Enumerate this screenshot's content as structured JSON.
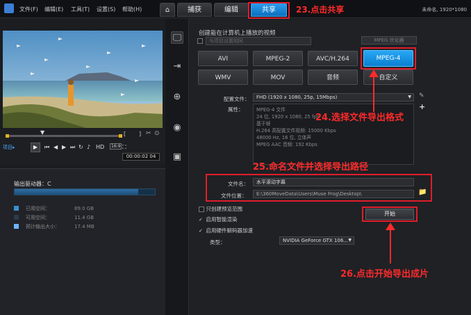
{
  "menu": [
    "文件(F)",
    "编辑(E)",
    "工具(T)",
    "设置(S)",
    "帮助(H)"
  ],
  "tabs": {
    "home_icon": "home-icon",
    "capture": "捕获",
    "edit": "编辑",
    "share": "共享"
  },
  "project_info": "未命名, 1920*1080",
  "annotations": {
    "step23": "23.点击共享",
    "step24": "24.选择文件导出格式",
    "step25": "25.命名文件并选择导出路径",
    "step26": "26.点击开始导出成片"
  },
  "player": {
    "mode_label": "项目▸",
    "timecode": "00:00:02 04",
    "hd_label": "HD",
    "ratio_label": "16:9"
  },
  "drive": {
    "label": "输出驱动器：C",
    "used_fraction": 0.88,
    "rows": [
      {
        "label": "已用空间：",
        "value": "89.0 GB",
        "color": "#3a8fd0"
      },
      {
        "label": "可用空间：",
        "value": "11.4 GB",
        "color": "#2b3a4a"
      },
      {
        "label": "预计输出大小：",
        "value": "17.4 MB",
        "color": "#6fb4ff"
      }
    ]
  },
  "share": {
    "heading": "创建能在计算机上播放的视频",
    "sub_option": "与项目设置相同",
    "mpeg_opt": "MPEG 优化器",
    "formats_row1": [
      "AVI",
      "MPEG-2",
      "AVC/H.264",
      "MPEG-4"
    ],
    "formats_row2": [
      "WMV",
      "MOV",
      "音频",
      "自定义"
    ],
    "selected_format": "MPEG-4",
    "profile_label": "配置文件：",
    "profile_value": "FHD (1920 x 1080, 25p, 15Mbps)",
    "props_label": "属性：",
    "props_lines": [
      "MPEG-4 文件",
      "24 位, 1920 x 1080, 25 fps",
      "基于帧",
      "H.264 高配置文件视频: 15000 Kbps",
      "48000 Hz, 16 位, 立体声",
      "MPEG AAC 音频: 192 Kbps"
    ],
    "filename_label": "文件名：",
    "filename_value": "水平滚动字幕",
    "location_label": "文件位置：",
    "location_value": "E:\\360MoveData\\Users\\Muse Frog\\Desktop\\",
    "options": [
      {
        "label": "只创建预览范围",
        "checked": false
      },
      {
        "label": "启用智能渲染",
        "checked": true
      },
      {
        "label": "启用硬件解码器加速",
        "checked": true
      }
    ],
    "type_label": "类型：",
    "type_value": "NVIDIA GeForce GTX 106...",
    "start_button": "开始"
  }
}
